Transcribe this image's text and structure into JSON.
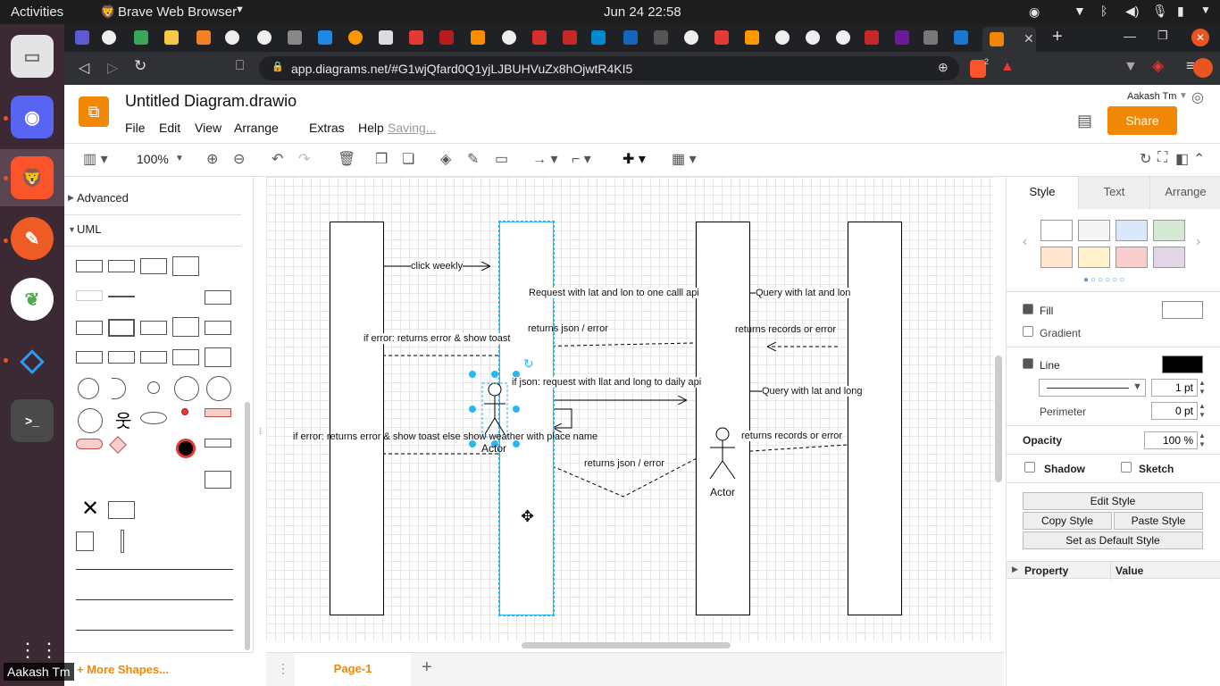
{
  "system": {
    "activities": "Activities",
    "app_name": "Brave Web Browser",
    "clock": "Jun 24  22:58",
    "user_label": "Aakash Tm"
  },
  "browser": {
    "url": "app.diagrams.net/#G1wjQfard0Q1yjLJBUHVuZx8hOjwtR4KI5",
    "shield_count": "2"
  },
  "drawio": {
    "file_title": "Untitled Diagram.drawio",
    "menu": [
      "File",
      "Edit",
      "View",
      "Arrange",
      "Extras",
      "Help"
    ],
    "saving": "Saving...",
    "account": "Aakash Tm",
    "share": "Share",
    "zoom": "100%",
    "sidebar": {
      "advanced": "Advanced",
      "uml": "UML",
      "more_shapes": "+ More Shapes..."
    },
    "page_tab": "Page-1",
    "diagram": {
      "messages": [
        "click weekly",
        "Request  with lat and lon to one calll api",
        "Query with lat and lon",
        "returns json / error",
        "returns records or error",
        "if error: returns error & show toast",
        "if json: request with llat and long to daily api",
        "Query with lat and long",
        "if error: returns error & show toast else show weather with place name",
        "returns records or error",
        "returns json / error"
      ],
      "actor1": "Actor",
      "actor2": "Actor"
    },
    "format_panel": {
      "tabs": [
        "Style",
        "Text",
        "Arrange"
      ],
      "fill": "Fill",
      "gradient": "Gradient",
      "line": "Line",
      "line_width": "1 pt",
      "perimeter": "Perimeter",
      "perimeter_value": "0 pt",
      "opacity": "Opacity",
      "opacity_value": "100 %",
      "shadow": "Shadow",
      "sketch": "Sketch",
      "edit_style": "Edit Style",
      "copy_style": "Copy Style",
      "paste_style": "Paste Style",
      "set_default": "Set as Default Style",
      "property": "Property",
      "value": "Value",
      "swatches": [
        "#ffffff",
        "#f5f5f5",
        "#dae8fc",
        "#d5e8d4",
        "#ffe6cc",
        "#fff2cc",
        "#f8cecc",
        "#e1d5e7"
      ]
    }
  }
}
